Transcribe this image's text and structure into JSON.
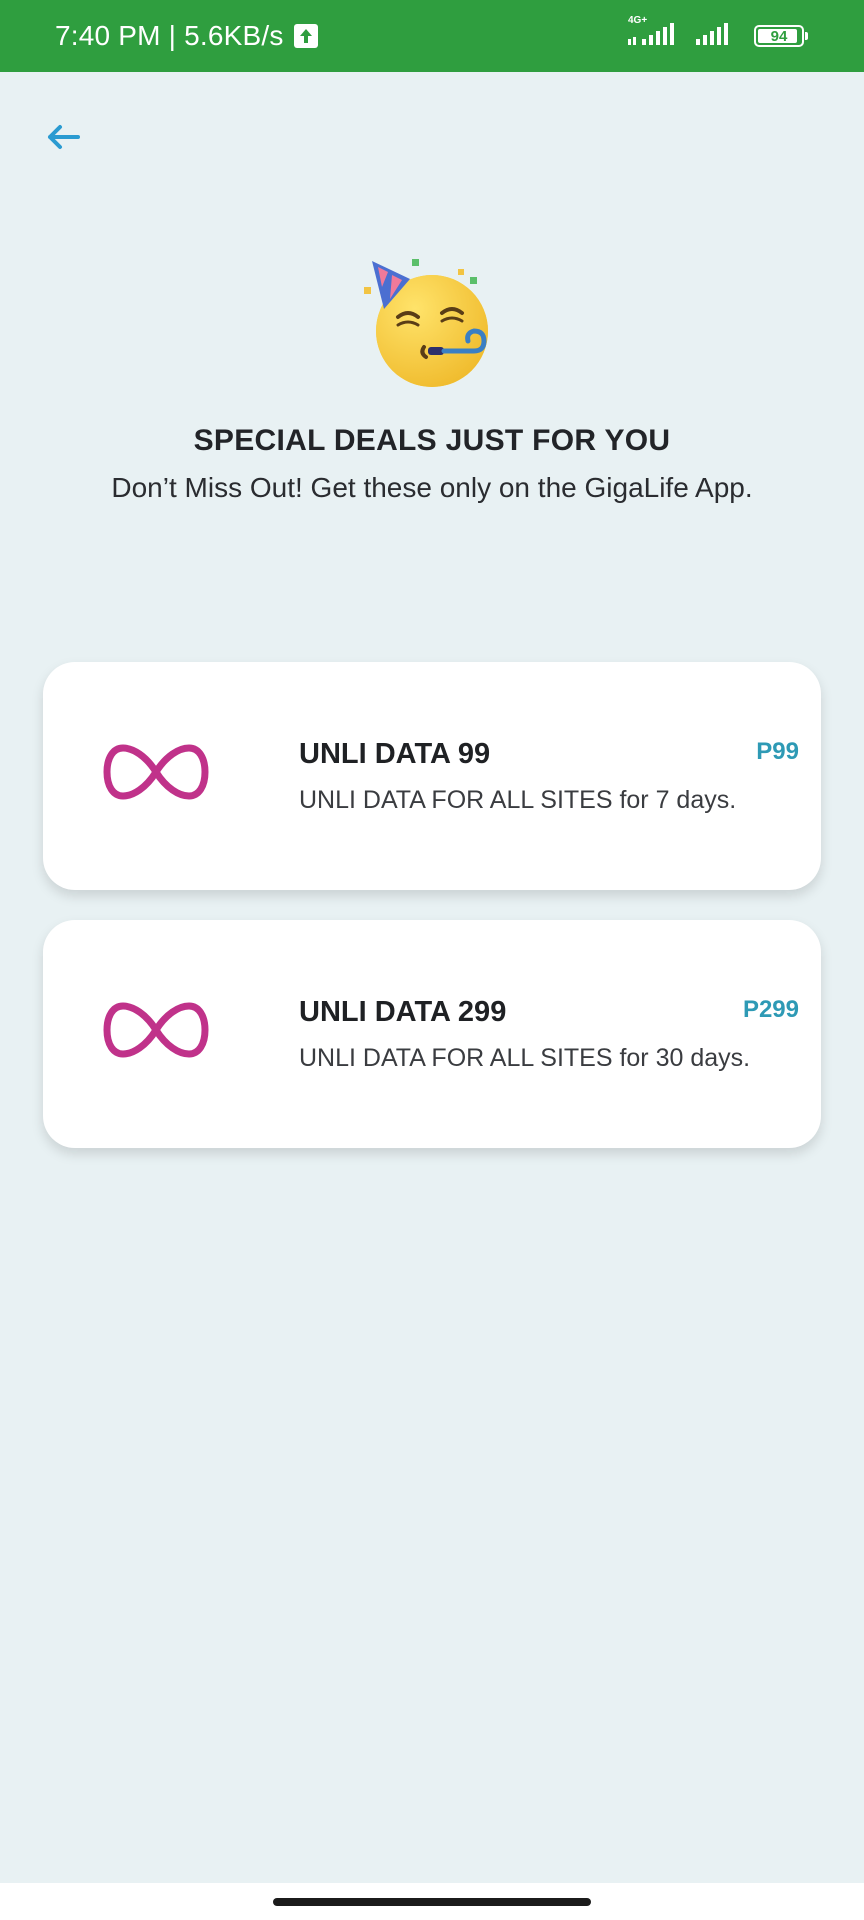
{
  "status_bar": {
    "time_speed": "7:40 PM | 5.6KB/s",
    "network_label": "4G+",
    "battery_level": "94",
    "battery_fraction": 0.94
  },
  "header": {
    "back_icon": "arrow-left-icon"
  },
  "hero": {
    "emoji": "party-face-icon",
    "title": "SPECIAL DEALS JUST FOR YOU",
    "subtitle": "Don’t Miss Out! Get these only on the GigaLife App."
  },
  "deals": [
    {
      "icon": "infinity-icon",
      "name": "UNLI DATA 99",
      "description": "UNLI DATA FOR ALL SITES for 7 days.",
      "price": "P99"
    },
    {
      "icon": "infinity-icon",
      "name": "UNLI DATA 299",
      "description": "UNLI DATA FOR ALL SITES for 30 days.",
      "price": "P299"
    }
  ],
  "colors": {
    "status_bar": "#2f9e3f",
    "background": "#e8f1f3",
    "accent_blue": "#2a9bd1",
    "price_teal": "#2e9ab5",
    "infinity_magenta": "#c0328a"
  }
}
